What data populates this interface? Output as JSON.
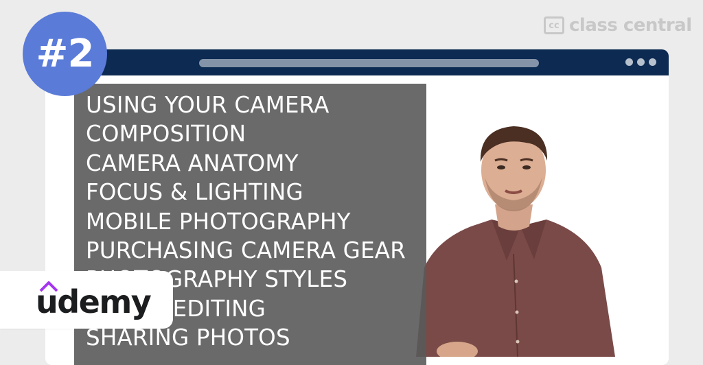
{
  "badge": {
    "label": "#2"
  },
  "brand": {
    "mark": "cc",
    "name": "class central"
  },
  "course": {
    "topics": [
      "USING YOUR CAMERA",
      "COMPOSITION",
      "CAMERA ANATOMY",
      "FOCUS & LIGHTING",
      "MOBILE PHOTOGRAPHY",
      "PURCHASING CAMERA GEAR",
      "PHOTOGRAPHY STYLES",
      "PHOTO EDITING",
      "SHARING PHOTOS"
    ]
  },
  "provider": {
    "name": "udemy",
    "hat_color": "#a435f0"
  },
  "colors": {
    "badge": "#5a7bd8",
    "titlebar": "#0c2a52",
    "overlay": "#5a5a5a",
    "shirt": "#7a4a48"
  },
  "icons": [
    "window-dots-icon",
    "udemy-hat-icon",
    "class-central-logo-icon"
  ]
}
